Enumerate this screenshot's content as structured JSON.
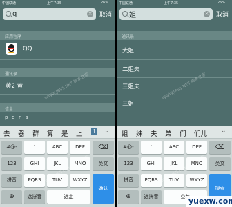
{
  "left": {
    "status": {
      "carrier": "中国联通",
      "time": "上午7:35",
      "battery": "26%"
    },
    "search": {
      "value": "q"
    },
    "cancel_label": "取消",
    "sections": {
      "apps": "应用程序",
      "contacts": "通讯录",
      "info": "信息"
    },
    "app_name": "QQ",
    "contact_name": "黄2 黄",
    "suggestion_letters": [
      "p",
      "q",
      "r",
      "s"
    ],
    "candidates": [
      "去",
      "器",
      "群",
      "算",
      "是",
      "上"
    ],
    "keys": {
      "k1": "#@-",
      "k2": "'",
      "k3": "ABC",
      "k4": "DEF",
      "k5": "123",
      "k6": "GHI",
      "k7": "JKL",
      "k8": "MNO",
      "k9": "英文",
      "k10": "拼音",
      "k11": "PQRS",
      "k12": "TUV",
      "k13": "WXYZ",
      "k14": "确认",
      "k15": "选拼音",
      "k16": "选定"
    }
  },
  "right": {
    "status": {
      "carrier": "中国联通",
      "time": "上午7:35",
      "battery": "26%"
    },
    "search": {
      "value": "姐"
    },
    "cancel_label": "取消",
    "contacts_header": "通讯录",
    "contacts": [
      "大姐",
      "二姐夫",
      "三姐夫",
      "三姐"
    ],
    "candidates": [
      "姐",
      "妹",
      "夫",
      "弟",
      "们",
      "们儿"
    ],
    "keys": {
      "k1": "#@-",
      "k2": "'",
      "k3": "ABC",
      "k4": "DEF",
      "k5": "123",
      "k6": "GHI",
      "k7": "JKL",
      "k8": "MNO",
      "k9": "英文",
      "k10": "拼音",
      "k11": "PQRS",
      "k12": "TUV",
      "k13": "WXYZ",
      "k14": "搜索",
      "k15": "选拼音",
      "k16": "空格"
    }
  },
  "watermark": "WWW.JB51.NET 脚本之家",
  "site_label": "yuexw.com",
  "colors": {
    "accent_blue": "#2e8fe8",
    "background": "#4e6d6c",
    "keyboard": "#d0d8d7"
  }
}
